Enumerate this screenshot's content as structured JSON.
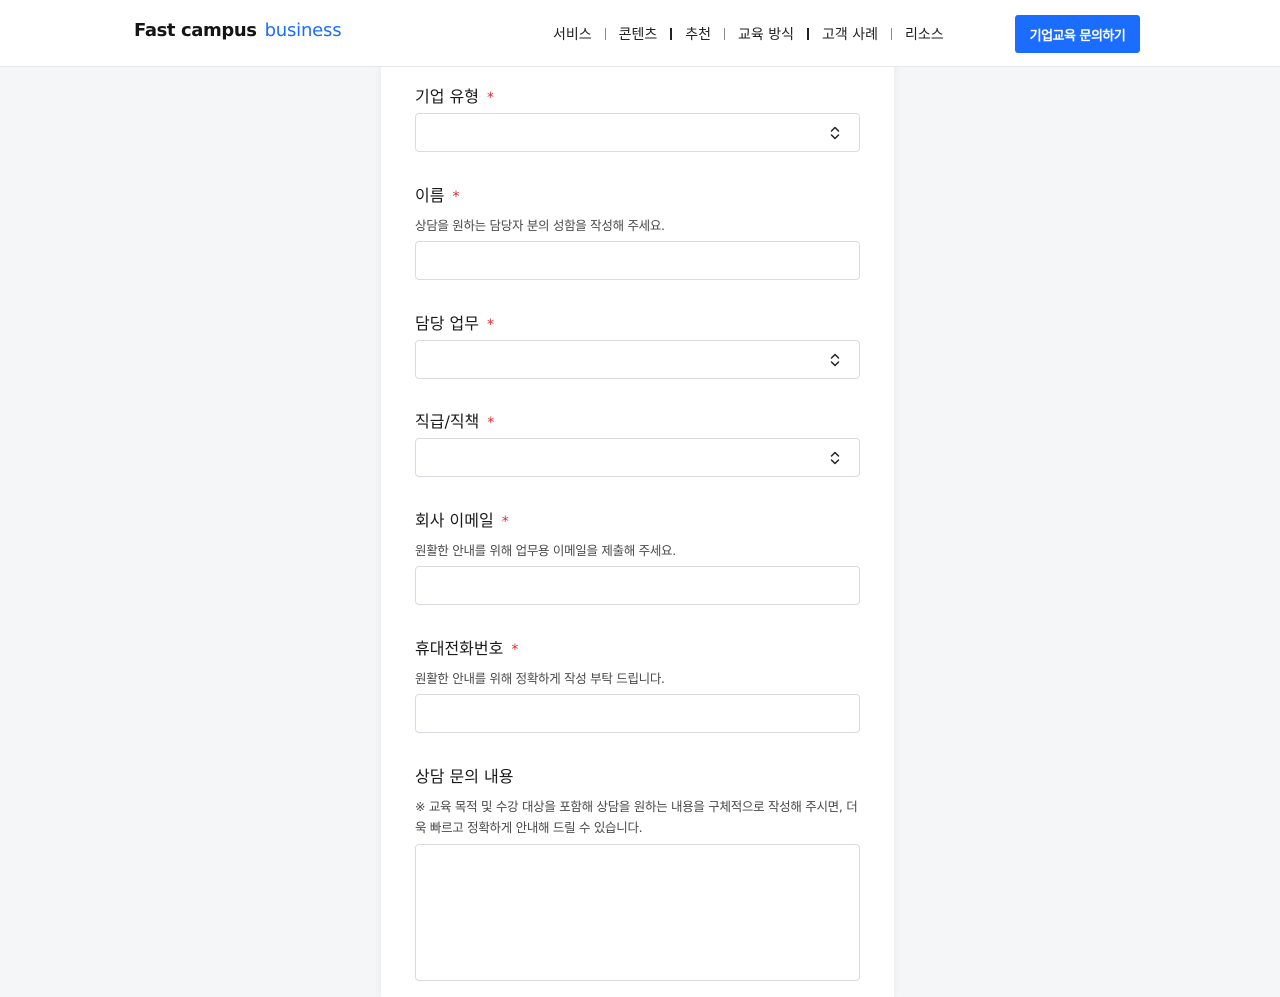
{
  "header": {
    "logo_main": "Fast campus",
    "logo_sub": "business",
    "nav": [
      "서비스",
      "콘텐츠",
      "추천",
      "교육 방식",
      "고객 사례",
      "리소스"
    ],
    "cta_label": "기업교육 문의하기"
  },
  "form": {
    "required_mark": "*",
    "company_type": {
      "label": "기업 유형",
      "value": ""
    },
    "name": {
      "label": "이름",
      "help": "상담을 원하는 담당자 분의 성함을 작성해 주세요.",
      "value": ""
    },
    "duty": {
      "label": "담당 업무",
      "value": ""
    },
    "position": {
      "label": "직급/직책",
      "value": ""
    },
    "email": {
      "label": "회사 이메일",
      "help": "원활한 안내를 위해 업무용 이메일을 제출해 주세요.",
      "value": ""
    },
    "phone": {
      "label": "휴대전화번호",
      "help": "원활한 안내를 위해 정확하게 작성 부탁 드립니다.",
      "value": ""
    },
    "inquiry": {
      "label": "상담 문의 내용",
      "help": "※ 교육 목적 및 수강 대상을 포함해 상담을 원하는 내용을 구체적으로 작성해 주시면, 더욱 빠르고 정확하게 안내해 드릴 수 있습니다.",
      "value": ""
    }
  },
  "colors": {
    "accent": "#1a6dff",
    "required": "#e0282e",
    "border": "#d8dbe0"
  }
}
